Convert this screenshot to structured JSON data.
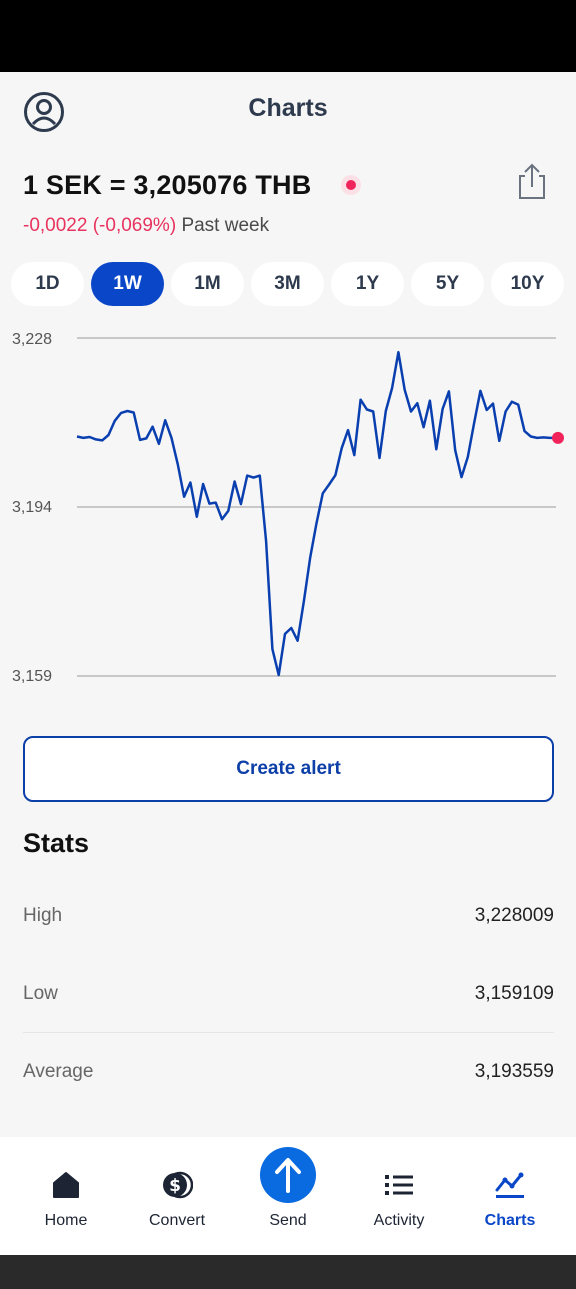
{
  "header": {
    "title": "Charts"
  },
  "rate": {
    "text": "1 SEK = 3,205076 THB",
    "change": "-0,0022 (-0,069%)",
    "period": "Past week"
  },
  "ranges": [
    "1D",
    "1W",
    "1M",
    "3M",
    "1Y",
    "5Y",
    "10Y"
  ],
  "active_range": "1W",
  "chart_data": {
    "type": "line",
    "y_ticks": [
      "3,228",
      "3,194",
      "3,159"
    ],
    "ylim": [
      3.159,
      3.228
    ],
    "grid": true,
    "series_color": "#0a3fb0",
    "end_marker_color": "#f0245a",
    "values": [
      3.2079,
      3.2076,
      3.2078,
      3.2073,
      3.2071,
      3.2082,
      3.2111,
      3.2127,
      3.2131,
      3.2128,
      3.2072,
      3.2075,
      3.2099,
      3.2064,
      3.2112,
      3.2076,
      3.2022,
      3.1956,
      3.1985,
      3.1915,
      3.1982,
      3.1942,
      3.1944,
      3.191,
      3.1927,
      3.1987,
      3.1941,
      3.1999,
      3.1995,
      3.1999,
      3.1865,
      3.1645,
      3.1592,
      3.1676,
      3.1688,
      3.1662,
      3.1743,
      3.1832,
      3.1902,
      3.1963,
      3.1981,
      3.2,
      3.2055,
      3.2092,
      3.2041,
      3.2154,
      3.2134,
      3.213,
      3.2035,
      3.2131,
      3.2178,
      3.2251,
      3.2174,
      3.213,
      3.2147,
      3.2098,
      3.2152,
      3.2053,
      3.2135,
      3.2171,
      3.2051,
      3.1996,
      3.2037,
      3.2106,
      3.2172,
      3.2133,
      3.2146,
      3.207,
      3.213,
      3.215,
      3.2144,
      3.209,
      3.2079,
      3.2076,
      3.2077,
      3.2076,
      3.2076
    ]
  },
  "create_alert_label": "Create alert",
  "stats": {
    "title": "Stats",
    "rows": [
      {
        "label": "High",
        "value": "3,228009"
      },
      {
        "label": "Low",
        "value": "3,159109"
      },
      {
        "label": "Average",
        "value": "3,193559"
      }
    ]
  },
  "nav": {
    "items": [
      {
        "label": "Home",
        "icon": "home-icon"
      },
      {
        "label": "Convert",
        "icon": "convert-icon"
      },
      {
        "label": "Send",
        "icon": "send-icon"
      },
      {
        "label": "Activity",
        "icon": "activity-icon"
      },
      {
        "label": "Charts",
        "icon": "charts-icon"
      }
    ],
    "active": "Charts"
  }
}
